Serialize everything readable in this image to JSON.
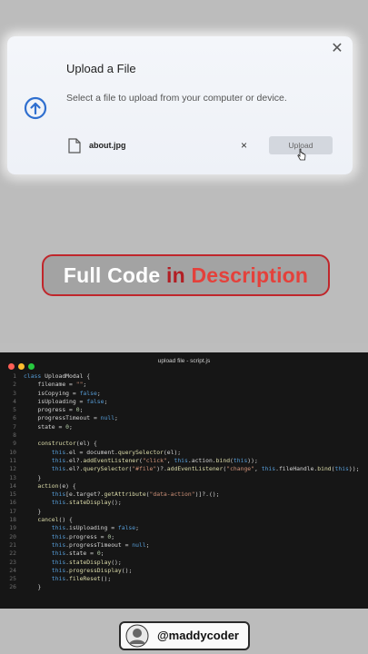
{
  "modal": {
    "title": "Upload a File",
    "subtitle": "Select a file to upload from your computer or device.",
    "file_name": "about.jpg",
    "remove_glyph": "×",
    "close_glyph": "✕",
    "upload_label": "Upload",
    "icons": [
      "upload-arrow-circle",
      "file-icon",
      "close-icon",
      "remove-icon",
      "mouse-cursor"
    ]
  },
  "banner": {
    "part1": "Full Code ",
    "part2": "in ",
    "part3": "Description"
  },
  "editor": {
    "title": "upload file - script.js",
    "dots": [
      "#ff5f56",
      "#ffbd2e",
      "#27c93f"
    ]
  },
  "code_lines": [
    "class UploadModal {",
    "    filename = \"\";",
    "    isCopying = false;",
    "    isUploading = false;",
    "    progress = 0;",
    "    progressTimeout = null;",
    "    state = 0;",
    "",
    "    constructor(el) {",
    "        this.el = document.querySelector(el);",
    "        this.el?.addEventListener(\"click\", this.action.bind(this));",
    "        this.el?.querySelector(\"#file\")?.addEventListener(\"change\", this.fileHandle.bind(this));",
    "    }",
    "    action(e) {",
    "        this[e.target?.getAttribute(\"data-action\")]?.();",
    "        this.stateDisplay();",
    "    }",
    "    cancel() {",
    "        this.isUploading = false;",
    "        this.progress = 0;",
    "        this.progressTimeout = null;",
    "        this.state = 0;",
    "        this.stateDisplay();",
    "        this.progressDisplay();",
    "        this.fileReset();",
    "    }"
  ],
  "handle": {
    "text": "@maddycoder"
  },
  "colors": {
    "accent_blue": "#2f6fcf",
    "banner_border": "#c0262b",
    "code_bg": "#161616"
  }
}
